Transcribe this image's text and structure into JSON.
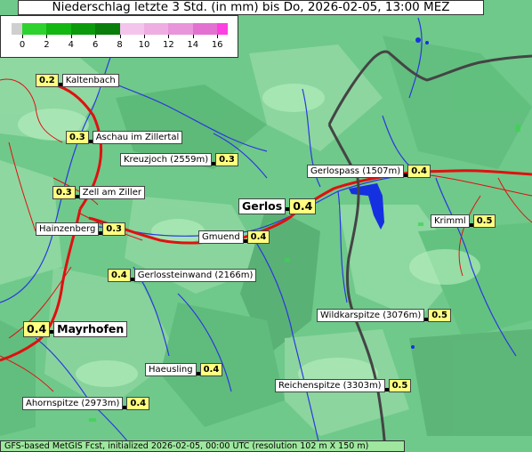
{
  "title": "Niederschlag letzte 3 Std. (in mm) bis Do, 2026-02-05, 13:00 MEZ",
  "legend": {
    "ticks": [
      "0",
      "2",
      "4",
      "6",
      "8",
      "10",
      "12",
      "14",
      "16"
    ],
    "colors": [
      "#cfcfcf",
      "#2ed22e",
      "#12b712",
      "#0b9a0b",
      "#0a7e0a",
      "#f4c4ec",
      "#eeaee2",
      "#e895dc",
      "#e371d2",
      "#ff40e0"
    ]
  },
  "places": [
    {
      "name": "Kaltenbach",
      "value": "0.2"
    },
    {
      "name": "Aschau im Zillertal",
      "value": "0.3"
    },
    {
      "name": "Kreuzjoch (2559m)",
      "value": "0.3"
    },
    {
      "name": "Zell am Ziller",
      "value": "0.3"
    },
    {
      "name": "Hainzenberg",
      "value": "0.3"
    },
    {
      "name": "Gerlos",
      "value": "0.4"
    },
    {
      "name": "Gmuend",
      "value": "0.4"
    },
    {
      "name": "Gerlospass (1507m)",
      "value": "0.4"
    },
    {
      "name": "Krimml",
      "value": "0.5"
    },
    {
      "name": "Gerlossteinwand (2166m)",
      "value": "0.4"
    },
    {
      "name": "Mayrhofen",
      "value": "0.4"
    },
    {
      "name": "Wildkarspitze (3076m)",
      "value": "0.5"
    },
    {
      "name": "Haeusling",
      "value": "0.4"
    },
    {
      "name": "Reichenspitze (3303m)",
      "value": "0.5"
    },
    {
      "name": "Ahornspitze (2973m)",
      "value": "0.4"
    }
  ],
  "footer": "GFS-based MetGIS Fcst, initialized 2026-02-05, 00:00 UTC  (resolution 102 m X 150 m)",
  "colors": {
    "terrain": "#6fc98a",
    "river": "#2a38e0",
    "road": "#e01010",
    "border": "#444444",
    "lake": "#1530e0",
    "value_box": "#ffff80"
  }
}
